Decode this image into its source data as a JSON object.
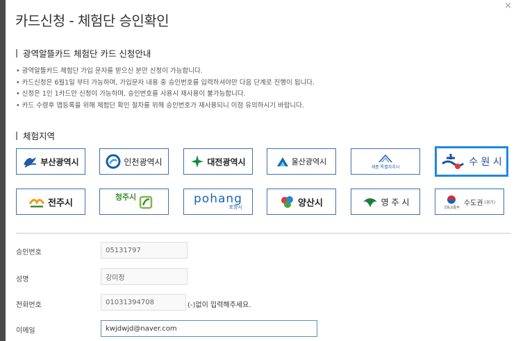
{
  "dialog": {
    "title": "카드신청 - 체험단 승인확인",
    "close_icon": "×"
  },
  "guide": {
    "heading": "광역알뜰카드 체험단 카드 신청안내",
    "items": [
      "광역알뜰카드 체험단 가입 문자를 받으신 분만 신청이 가능합니다.",
      "카드신청은 6월1일 부터 가능하며, 가입문자 내용 중 승인번호를 입력하셔야만 다음 단계로 진행이 됩니다.",
      "신청은 1인 1카드만 신청이 가능하며, 승인번호를 사용시 재사용이 불가능합니다.",
      "카드 수령후 앱등록을 위해 체험단 확인 절차를 위해 승인번호가 재사용되니 이점 유의하시기 바랍니다."
    ]
  },
  "regions": {
    "heading": "체험지역",
    "cities": [
      {
        "name": "부산광역시",
        "color": "#1e5aa8",
        "icon": "busan-logo-icon"
      },
      {
        "name": "인천광역시",
        "color": "#0f5ea8",
        "icon": "incheon-logo-icon"
      },
      {
        "name": "대전광역시",
        "color": "#0b8a3e",
        "icon": "daejeon-logo-icon"
      },
      {
        "name": "울산광역시",
        "color": "#0c6db3",
        "icon": "ulsan-logo-icon"
      },
      {
        "name": "세종",
        "sub": "특별자치시",
        "color": "#1e5aa8",
        "icon": "sejong-logo-icon"
      },
      {
        "name": "수 원 시",
        "color": "#1c4ea0",
        "icon": "suwon-logo-icon"
      },
      {
        "name": "전주시",
        "color": "#2b2b2b",
        "icon": "jeonju-logo-icon"
      },
      {
        "name": "청주시",
        "color": "#3a8d2f",
        "icon": "cheongju-logo-icon"
      },
      {
        "name": "pohang",
        "sub": "포항시",
        "color": "#1c63b5",
        "icon": "pohang-logo-icon"
      },
      {
        "name": "양산시",
        "color": "#2b2b2b",
        "icon": "yangsan-logo-icon"
      },
      {
        "name": "영 주 시",
        "color": "#2b2b2b",
        "icon": "yeongju-logo-icon"
      },
      {
        "name": "수도권",
        "sub": "(경기)",
        "caption": "국토교통부",
        "color": "#333333",
        "icon": "molit-logo-icon"
      }
    ]
  },
  "form": {
    "approval": {
      "label": "승인번호",
      "value": "05131797"
    },
    "name": {
      "label": "성명",
      "value": "강미정"
    },
    "phone": {
      "label": "전화번호",
      "value": "01031394708",
      "hint": "(-)없이 입력해주세요."
    },
    "email": {
      "label": "이메일",
      "value": "kwjdwjd@naver.com"
    }
  }
}
